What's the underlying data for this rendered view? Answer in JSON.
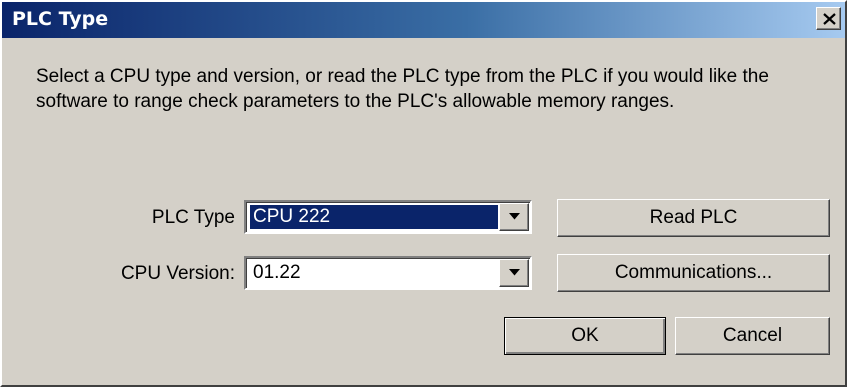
{
  "window": {
    "title": "PLC Type",
    "close_icon": "close-icon"
  },
  "description": "Select a CPU type and version, or read the PLC type from the PLC if you would like the software to range check parameters to the PLC's allowable memory ranges.",
  "fields": {
    "plc_type": {
      "label": "PLC Type",
      "value": "CPU 222"
    },
    "cpu_version": {
      "label": "CPU Version:",
      "value": "01.22"
    }
  },
  "buttons": {
    "read_plc": "Read PLC",
    "communications": "Communications...",
    "ok": "OK",
    "cancel": "Cancel"
  },
  "colors": {
    "title_bar_start": "#0a246a",
    "title_bar_end": "#a6caf0",
    "dialog_face": "#d4d0c8",
    "selection": "#0a246a"
  }
}
